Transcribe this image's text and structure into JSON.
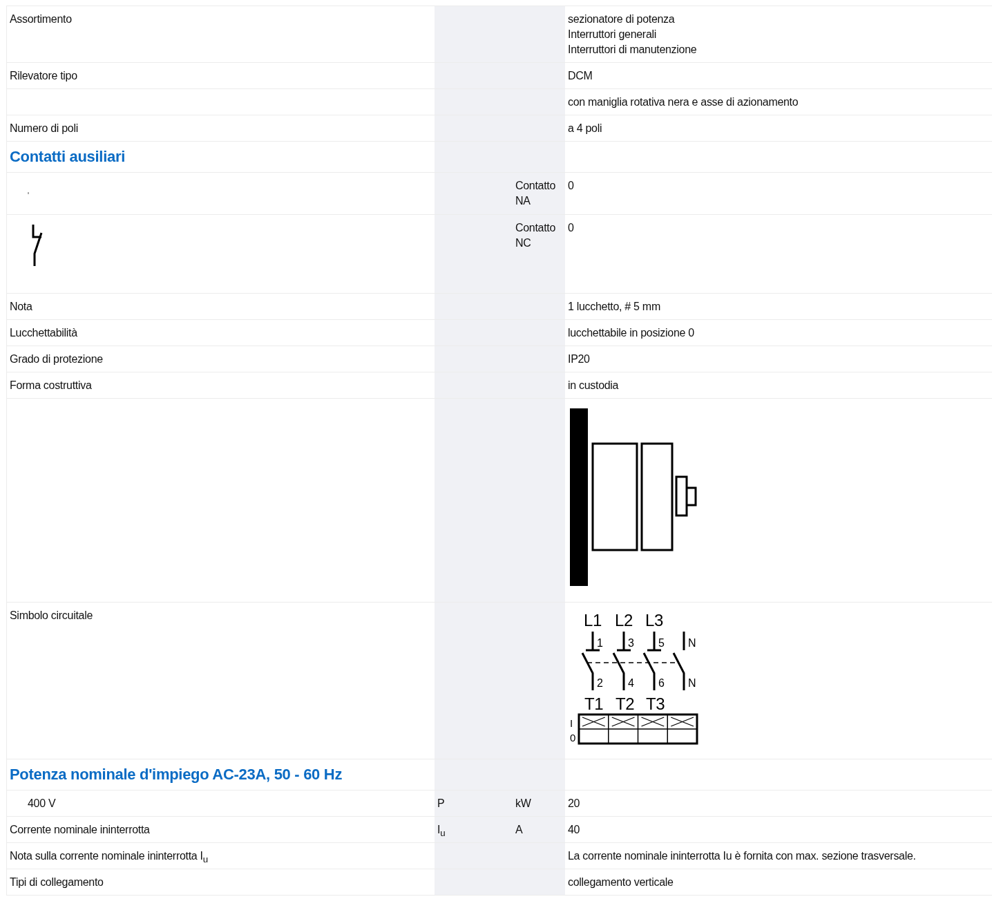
{
  "rows": [
    {
      "kind": "value",
      "label": "Assortimento",
      "values": [
        "sezionatore di potenza",
        "Interruttori generali",
        "Interruttori di manutenzione"
      ]
    },
    {
      "kind": "value",
      "label": "Rilevatore tipo",
      "values": [
        "DCM"
      ]
    },
    {
      "kind": "value",
      "values": [
        "con maniglia rotativa nera e asse di azionamento"
      ]
    },
    {
      "kind": "value",
      "label": "Numero di poli",
      "values": [
        "a 4 poli"
      ]
    },
    {
      "kind": "heading",
      "label": "Contatti ausiliari"
    },
    {
      "kind": "no-contact",
      "unit": "Contatto NA",
      "values": [
        "0"
      ]
    },
    {
      "kind": "nc-contact",
      "unit": "Contatto NC",
      "values": [
        "0"
      ]
    },
    {
      "kind": "value",
      "label": "Nota",
      "values": [
        "1 lucchetto, # 5 mm"
      ]
    },
    {
      "kind": "value",
      "label": "Lucchettabilità",
      "values": [
        "lucchettabile in posizione 0"
      ]
    },
    {
      "kind": "value",
      "label": "Grado di protezione",
      "values": [
        "IP20"
      ]
    },
    {
      "kind": "value",
      "label": "Forma costruttiva",
      "values": [
        "in custodia"
      ]
    },
    {
      "kind": "device-drawing"
    },
    {
      "kind": "circuit",
      "label": "Simbolo circuitale",
      "circuit": {
        "line_labels": [
          "L1",
          "L2",
          "L3"
        ],
        "top_terminals": [
          "1",
          "3",
          "5",
          "N"
        ],
        "bottom_terminals": [
          "2",
          "4",
          "6",
          "N"
        ],
        "load_labels": [
          "T1",
          "T2",
          "T3"
        ],
        "positions": [
          "I",
          "0"
        ]
      }
    },
    {
      "kind": "heading",
      "label": "Potenza nominale d'impiego AC-23A, 50 - 60 Hz"
    },
    {
      "kind": "value",
      "label": "400 V",
      "indent": true,
      "symbol": "P",
      "unit": "kW",
      "values": [
        "20"
      ]
    },
    {
      "kind": "value",
      "label": "Corrente nominale ininterrotta",
      "symbol": "I$_{u}$",
      "unit": "A",
      "values": [
        "40"
      ]
    },
    {
      "kind": "value",
      "label": "Nota sulla corrente nominale ininterrotta I$_{u}$",
      "values": [
        "La corrente nominale ininterrotta Iu è fornita con max. sezione trasversale."
      ]
    },
    {
      "kind": "value",
      "label": "Tipi di collegamento",
      "values": [
        "collegamento verticale"
      ]
    }
  ]
}
